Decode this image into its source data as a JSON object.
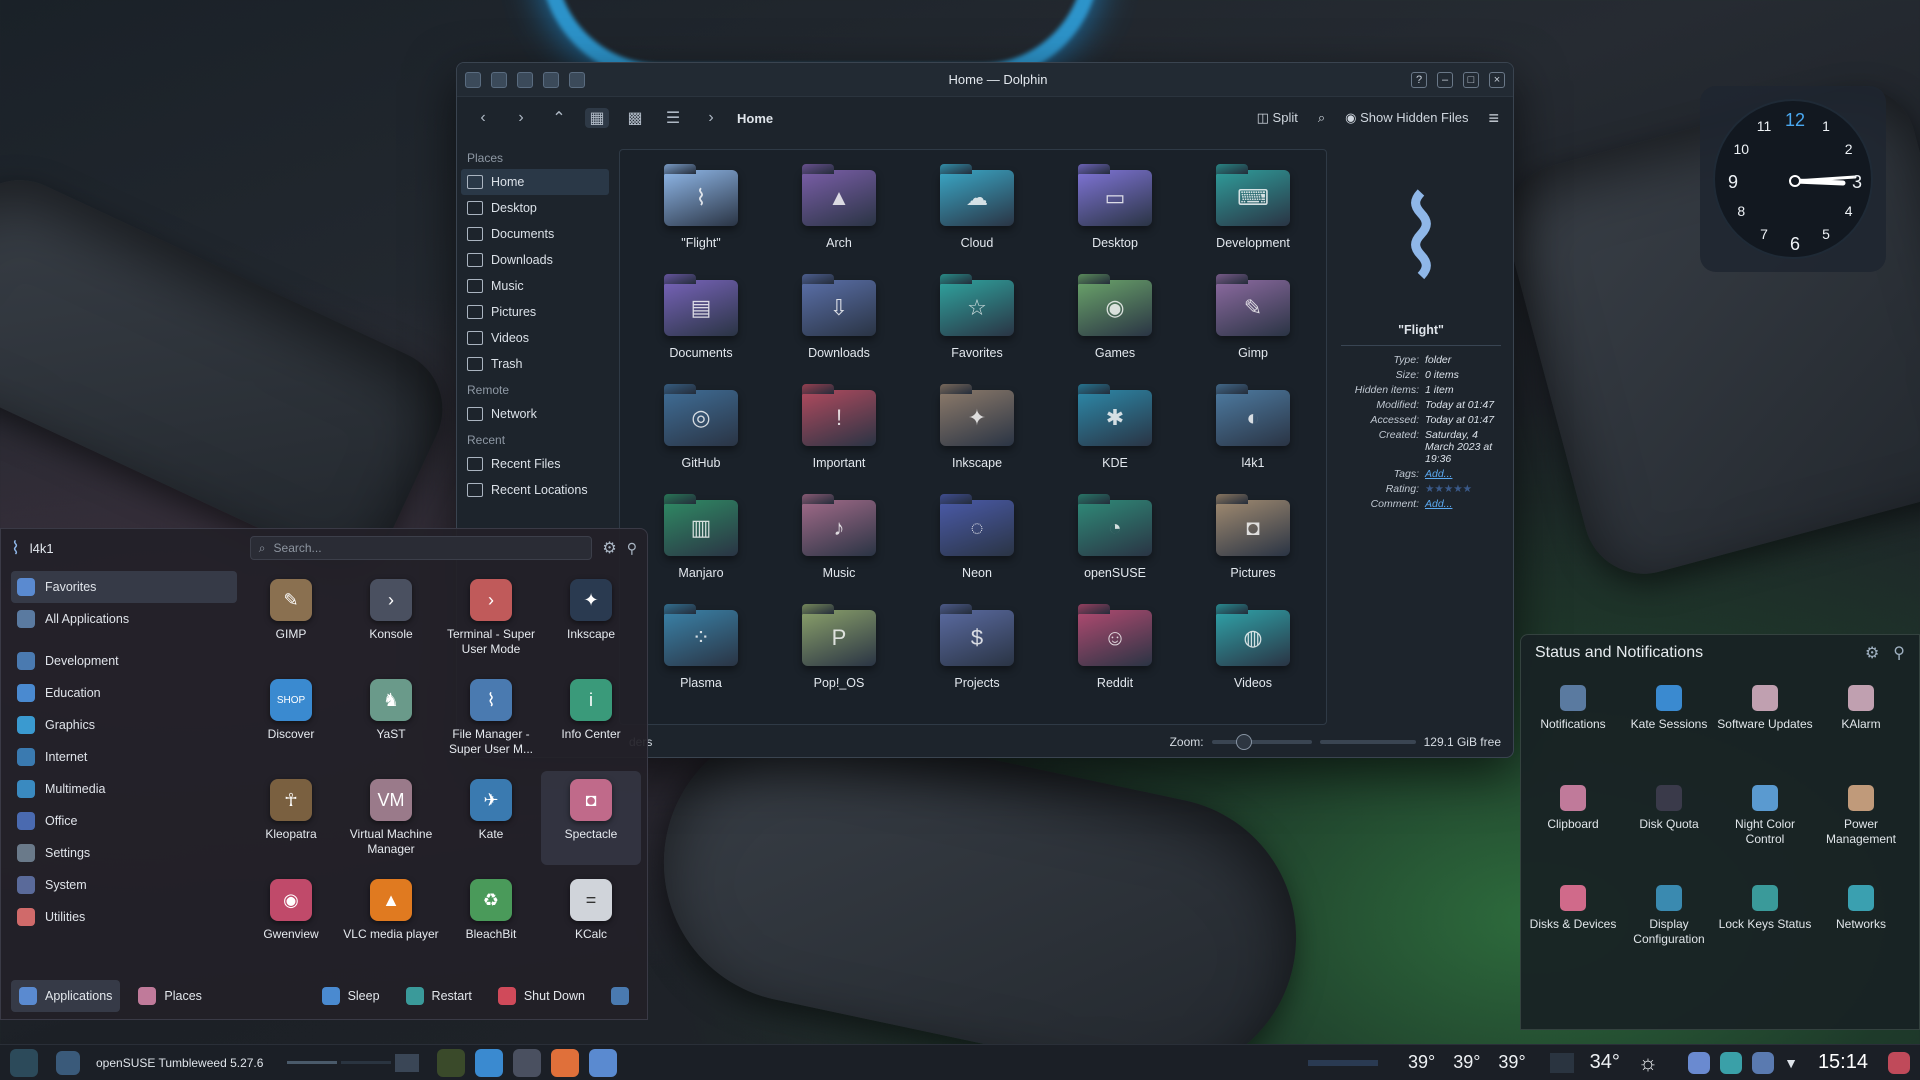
{
  "window": {
    "title": "Home — Dolphin",
    "breadcrumb": "Home",
    "split_label": "Split",
    "hidden_files_label": "Show Hidden Files",
    "help": "?",
    "min": "–",
    "max": "□",
    "close": "×"
  },
  "places": {
    "heading_places": "Places",
    "items": [
      "Home",
      "Desktop",
      "Documents",
      "Downloads",
      "Music",
      "Pictures",
      "Videos",
      "Trash"
    ],
    "heading_remote": "Remote",
    "remote": [
      "Network"
    ],
    "heading_recent": "Recent",
    "recent": [
      "Recent Files",
      "Recent Locations"
    ]
  },
  "folders": [
    {
      "name": "\"Flight\"",
      "color": "#8fb7e8",
      "glyph": "⌇"
    },
    {
      "name": "Arch",
      "color": "#7a5ea8",
      "glyph": "▲"
    },
    {
      "name": "Cloud",
      "color": "#3aa7c6",
      "glyph": "☁"
    },
    {
      "name": "Desktop",
      "color": "#7f74d6",
      "glyph": "▭"
    },
    {
      "name": "Development",
      "color": "#2f9c9a",
      "glyph": "⌨"
    },
    {
      "name": "Documents",
      "color": "#7763b9",
      "glyph": "▤"
    },
    {
      "name": "Downloads",
      "color": "#5a6fa8",
      "glyph": "⇩"
    },
    {
      "name": "Favorites",
      "color": "#2fa39e",
      "glyph": "☆"
    },
    {
      "name": "Games",
      "color": "#6aa36a",
      "glyph": "◉"
    },
    {
      "name": "Gimp",
      "color": "#8c6aa0",
      "glyph": "✎"
    },
    {
      "name": "GitHub",
      "color": "#3f6d96",
      "glyph": "◎"
    },
    {
      "name": "Important",
      "color": "#b04a5e",
      "glyph": "!"
    },
    {
      "name": "Inkscape",
      "color": "#8c7a6a",
      "glyph": "✦"
    },
    {
      "name": "KDE",
      "color": "#2c88a8",
      "glyph": "✱"
    },
    {
      "name": "l4k1",
      "color": "#4d7aa0",
      "glyph": "◐"
    },
    {
      "name": "Manjaro",
      "color": "#2f8a64",
      "glyph": "▥"
    },
    {
      "name": "Music",
      "color": "#a06a88",
      "glyph": "♪"
    },
    {
      "name": "Neon",
      "color": "#4a5aa8",
      "glyph": "◌"
    },
    {
      "name": "openSUSE",
      "color": "#2f8a78",
      "glyph": "◔"
    },
    {
      "name": "Pictures",
      "color": "#a08a70",
      "glyph": "◘"
    },
    {
      "name": "Plasma",
      "color": "#3a82a8",
      "glyph": "⁘"
    },
    {
      "name": "Pop!_OS",
      "color": "#8aa06a",
      "glyph": "P"
    },
    {
      "name": "Projects",
      "color": "#5a6aa0",
      "glyph": "$"
    },
    {
      "name": "Reddit",
      "color": "#b04a70",
      "glyph": "☺"
    },
    {
      "name": "Videos",
      "color": "#2fa2a8",
      "glyph": "◍"
    }
  ],
  "info": {
    "name": "\"Flight\"",
    "rows": [
      {
        "k": "Type:",
        "v": "folder",
        "link": false
      },
      {
        "k": "Size:",
        "v": "0 items",
        "link": false
      },
      {
        "k": "Hidden items:",
        "v": "1 item",
        "link": false
      },
      {
        "k": "Modified:",
        "v": "Today at 01:47",
        "link": false
      },
      {
        "k": "Accessed:",
        "v": "Today at 01:47",
        "link": false
      },
      {
        "k": "Created:",
        "v": "Saturday, 4 March 2023 at 19:36",
        "link": false
      },
      {
        "k": "Tags:",
        "v": "Add...",
        "link": true
      },
      {
        "k": "Rating:",
        "v": "★★★★★",
        "link": false
      },
      {
        "k": "Comment:",
        "v": "Add...",
        "link": true
      }
    ]
  },
  "statusbar": {
    "left": "ders",
    "zoom_label": "Zoom:",
    "free": "129.1 GiB free"
  },
  "launcher": {
    "user": "l4k1",
    "search_placeholder": "Search...",
    "categories": [
      {
        "label": "Favorites",
        "color": "#5a8ad0"
      },
      {
        "label": "All Applications",
        "color": "#5a7aa0"
      },
      {
        "label": "Development",
        "color": "#4a7ab0"
      },
      {
        "label": "Education",
        "color": "#4a8ad0"
      },
      {
        "label": "Graphics",
        "color": "#3a9ad0"
      },
      {
        "label": "Internet",
        "color": "#3a7ab0"
      },
      {
        "label": "Multimedia",
        "color": "#3a8ac0"
      },
      {
        "label": "Office",
        "color": "#4a6ab0"
      },
      {
        "label": "Settings",
        "color": "#6a7a8a"
      },
      {
        "label": "System",
        "color": "#5a6a9a"
      },
      {
        "label": "Utilities",
        "color": "#d06a6a"
      }
    ],
    "apps": [
      {
        "label": "GIMP",
        "color": "#8a7050",
        "glyph": "✎"
      },
      {
        "label": "Konsole",
        "color": "#4a5060",
        "glyph": "›"
      },
      {
        "label": "Terminal - Super User Mode",
        "color": "#c05a5a",
        "glyph": "›"
      },
      {
        "label": "Inkscape",
        "color": "#2a3a50",
        "glyph": "✦"
      },
      {
        "label": "Discover",
        "color": "#3a8ad0",
        "glyph": "SHOP"
      },
      {
        "label": "YaST",
        "color": "#6a9a8a",
        "glyph": "♞"
      },
      {
        "label": "File Manager - Super User M...",
        "color": "#4a7ab0",
        "glyph": "⌇"
      },
      {
        "label": "Info Center",
        "color": "#3a9a7a",
        "glyph": "i"
      },
      {
        "label": "Kleopatra",
        "color": "#7a6040",
        "glyph": "☥"
      },
      {
        "label": "Virtual Machine Manager",
        "color": "#9a7a8a",
        "glyph": "VM"
      },
      {
        "label": "Kate",
        "color": "#3a7ab0",
        "glyph": "✈"
      },
      {
        "label": "Spectacle",
        "color": "#c06a8a",
        "glyph": "◘"
      },
      {
        "label": "Gwenview",
        "color": "#c04a6a",
        "glyph": "◉"
      },
      {
        "label": "VLC media player",
        "color": "#e07a20",
        "glyph": "▲"
      },
      {
        "label": "BleachBit",
        "color": "#4a9a5a",
        "glyph": "♻"
      },
      {
        "label": "KCalc",
        "color": "#d0d4da",
        "glyph": "="
      }
    ],
    "footer": {
      "applications": "Applications",
      "places": "Places",
      "sleep": "Sleep",
      "restart": "Restart",
      "shutdown": "Shut Down"
    }
  },
  "clock": {
    "numbers": [
      "12",
      "1",
      "2",
      "3",
      "4",
      "5",
      "6",
      "7",
      "8",
      "9",
      "10",
      "11"
    ]
  },
  "status_panel": {
    "title": "Status and Notifications",
    "items": [
      {
        "label": "Notifications",
        "color": "#5a7aa0"
      },
      {
        "label": "Kate Sessions",
        "color": "#3a8ad0"
      },
      {
        "label": "Software Updates",
        "color": "#c0a0b0"
      },
      {
        "label": "KAlarm",
        "color": "#c0a0b0"
      },
      {
        "label": "Clipboard",
        "color": "#c07a9a"
      },
      {
        "label": "Disk Quota",
        "color": "#3a3a4a"
      },
      {
        "label": "Night Color Control",
        "color": "#5a9ad0"
      },
      {
        "label": "Power Management",
        "color": "#c09a7a"
      },
      {
        "label": "Disks & Devices",
        "color": "#d06a8a"
      },
      {
        "label": "Display Configuration",
        "color": "#3a8ab0"
      },
      {
        "label": "Lock Keys Status",
        "color": "#3a9a9a"
      },
      {
        "label": "Networks",
        "color": "#3aa0b0"
      }
    ]
  },
  "taskbar": {
    "window_title": "openSUSE Tumbleweed 5.27.6",
    "temps": [
      "39°",
      "39°",
      "39°"
    ],
    "weather_temp": "34°",
    "time": "15:14"
  }
}
